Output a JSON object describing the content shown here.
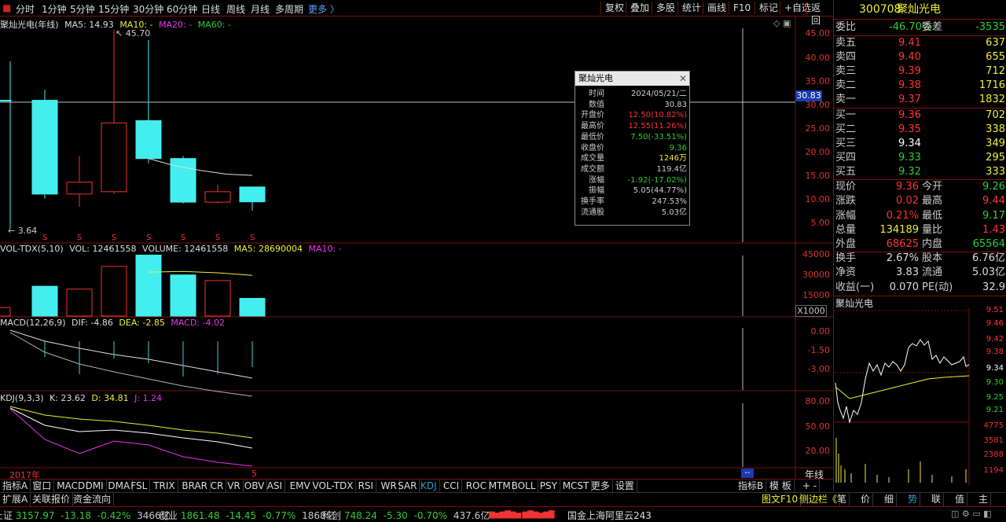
{
  "menu": {
    "periods": [
      "分时",
      "1分钟",
      "5分钟",
      "15分钟",
      "30分钟",
      "60分钟",
      "日线",
      "周线",
      "月线",
      "多周期"
    ],
    "more": "更多 〉",
    "tools": [
      "复权",
      "叠加",
      "多股",
      "统计",
      "画线",
      "F10",
      "标记",
      "+自选",
      "返回"
    ]
  },
  "kline": {
    "title": "聚灿光电(年线)",
    "ma5": "MA5: 14.93",
    "ma10": "MA10: -",
    "ma20": "MA20: -",
    "ma60": "MA60: -",
    "high_label": "45.70",
    "low_label": "3.64",
    "cursor_price": "30.83",
    "axis": [
      "45.00",
      "40.00",
      "35.00",
      "30.00",
      "25.00",
      "20.00",
      "15.00",
      "10.00",
      "5.00"
    ],
    "candles": [
      {
        "o": 30.8,
        "h": 39.0,
        "l": 3.64,
        "c": 30.8,
        "up": false
      },
      {
        "o": 30.8,
        "h": 33.0,
        "l": 10.0,
        "c": 11.0,
        "up": false
      },
      {
        "o": 11.0,
        "h": 19.0,
        "l": 8.3,
        "c": 13.5,
        "up": true
      },
      {
        "o": 11.5,
        "h": 45.7,
        "l": 11.0,
        "c": 26.0,
        "up": true
      },
      {
        "o": 26.5,
        "h": 43.5,
        "l": 17.5,
        "c": 18.5,
        "up": false
      },
      {
        "o": 18.5,
        "h": 19.0,
        "l": 9.0,
        "c": 9.3,
        "up": false
      },
      {
        "o": 9.3,
        "h": 13.0,
        "l": 9.0,
        "c": 11.5,
        "up": true
      },
      {
        "o": 12.5,
        "h": 12.55,
        "l": 7.5,
        "c": 9.36,
        "up": false
      }
    ],
    "ma5_line": [
      18.5,
      17.0,
      16.0,
      15.2,
      14.93
    ]
  },
  "volume": {
    "title": "VOL-TDX(5,10)",
    "vol": "VOL: 12461558",
    "volume": "VOLUME: 12461558",
    "ma5": "MA5: 28690004",
    "ma10": "MA10: -",
    "unit": "X1000",
    "axis": [
      "45000",
      "30000",
      "15000"
    ],
    "bars": [
      {
        "v": 6000,
        "up": true
      },
      {
        "v": 21000,
        "up": false
      },
      {
        "v": 19000,
        "up": true
      },
      {
        "v": 35000,
        "up": true
      },
      {
        "v": 43000,
        "up": false
      },
      {
        "v": 29000,
        "up": false
      },
      {
        "v": 25000,
        "up": true
      },
      {
        "v": 12461.558,
        "up": false
      }
    ],
    "ma5_line": [
      31000,
      31500,
      30500,
      28690
    ]
  },
  "macd": {
    "title": "MACD(12,26,9)",
    "dif": "DIF: -4.86",
    "dea": "DEA: -2.85",
    "macd": "MACD: -4.02",
    "axis": [
      "0.00",
      "-1.50",
      "-3.00"
    ]
  },
  "kdj": {
    "title": "KDJ(9,3,3)",
    "k": "K: 23.62",
    "d": "D: 34.81",
    "j": "J: 1.24",
    "axis": [
      "80.00",
      "50.00",
      "20.00"
    ],
    "year_label": "2017年",
    "end_label": "5"
  },
  "period_label": "年线",
  "tooltip": {
    "title": "聚灿光电",
    "rows": [
      {
        "k": "时间",
        "v": "2024/05/21/二",
        "c": "#ccc"
      },
      {
        "k": "数值",
        "v": "30.83",
        "c": "#ccc"
      },
      {
        "k": "开盘价",
        "v": "12.50(10.82%)",
        "c": "#f33"
      },
      {
        "k": "最高价",
        "v": "12.55(11.26%)",
        "c": "#f33"
      },
      {
        "k": "最低价",
        "v": "7.50(-33.51%)",
        "c": "#3c3"
      },
      {
        "k": "收盘价",
        "v": "9.36",
        "c": "#3c3"
      },
      {
        "k": "成交量",
        "v": "1246万",
        "c": "#ee3"
      },
      {
        "k": "成交额",
        "v": "119.4亿",
        "c": "#ccc"
      },
      {
        "k": "涨幅",
        "v": "-1.92(-17.02%)",
        "c": "#3c3"
      },
      {
        "k": "振幅",
        "v": "5.05(44.77%)",
        "c": "#ccc"
      },
      {
        "k": "换手率",
        "v": "247.53%",
        "c": "#ccc"
      },
      {
        "k": "流通股",
        "v": "5.03亿",
        "c": "#ccc"
      }
    ]
  },
  "quote": {
    "code": "300708",
    "name": "聚灿光电",
    "weibi_label": "委比",
    "weibi": "-46.70%",
    "weicha_label": "委差",
    "weicha": "-3535",
    "asks": [
      {
        "label": "卖五",
        "price": "9.41",
        "vol": "637"
      },
      {
        "label": "卖四",
        "price": "9.40",
        "vol": "655"
      },
      {
        "label": "卖三",
        "price": "9.39",
        "vol": "712"
      },
      {
        "label": "卖二",
        "price": "9.38",
        "vol": "1716"
      },
      {
        "label": "卖一",
        "price": "9.37",
        "vol": "1832"
      }
    ],
    "bids": [
      {
        "label": "买一",
        "price": "9.36",
        "vol": "702"
      },
      {
        "label": "买二",
        "price": "9.35",
        "vol": "338"
      },
      {
        "label": "买三",
        "price": "9.34",
        "vol": "349"
      },
      {
        "label": "买四",
        "price": "9.33",
        "vol": "295"
      },
      {
        "label": "买五",
        "price": "9.32",
        "vol": "333"
      }
    ],
    "stats": [
      {
        "l1": "现价",
        "v1": "9.36",
        "l2": "今开",
        "v2": "9.26"
      },
      {
        "l1": "涨跌",
        "v1": "0.02",
        "l2": "最高",
        "v2": "9.44"
      },
      {
        "l1": "涨幅",
        "v1": "0.21%",
        "l2": "最低",
        "v2": "9.17"
      },
      {
        "l1": "总量",
        "v1": "134189",
        "l2": "量比",
        "v2": "1.43"
      },
      {
        "l1": "外盘",
        "v1": "68625",
        "l2": "内盘",
        "v2": "65564"
      }
    ],
    "stats2": [
      {
        "l1": "换手",
        "v1": "2.67%",
        "l2": "股本",
        "v2": "6.76亿"
      },
      {
        "l1": "净资",
        "v1": "3.83",
        "l2": "流通",
        "v2": "5.03亿"
      },
      {
        "l1": "收益(一)",
        "v1": "0.070",
        "l2": "PE(动)",
        "v2": "32.9"
      }
    ],
    "mini_title": "聚灿光电",
    "mini_axis": [
      "9.51",
      "9.46",
      "9.42",
      "9.38",
      "9.34",
      "9.30",
      "9.25",
      "9.21",
      "4775",
      "3581",
      "2388",
      "1194"
    ]
  },
  "indicator_tabs": [
    "指标A",
    "窗口",
    "MACD",
    "DMI",
    "DMA",
    "FSL",
    "TRIX",
    "BRAR",
    "CR",
    "VR",
    "OBV",
    "ASI",
    "EMV",
    "VOL-TDX",
    "RSI",
    "WR",
    "SAR",
    "KDJ",
    "CCI",
    "ROC",
    "MTM",
    "BOLL",
    "PSY",
    "MCST",
    "更多",
    "设置"
  ],
  "indicator_right": [
    "指标B",
    "模 板"
  ],
  "bottom_tabs": [
    "扩展A",
    "关联报价",
    "资金流向"
  ],
  "bottom_right": {
    "f10": "图文F10",
    "side": "侧边栏《",
    "tabs": [
      "笔",
      "价",
      "细",
      "势",
      "联",
      "值",
      "主"
    ]
  },
  "status": {
    "sh": {
      "label": "上证",
      "val": "3157.97",
      "chg": "-13.18",
      "pct": "-0.42%",
      "amt": "3466亿"
    },
    "cy": {
      "label": "创业",
      "val": "1861.48",
      "chg": "-14.45",
      "pct": "-0.77%",
      "amt": "1868亿"
    },
    "kc": {
      "label": "科创",
      "val": "748.24",
      "chg": "-5.30",
      "pct": "-0.70%",
      "amt": "437.6亿"
    },
    "server": "国金上海阿里云243"
  }
}
